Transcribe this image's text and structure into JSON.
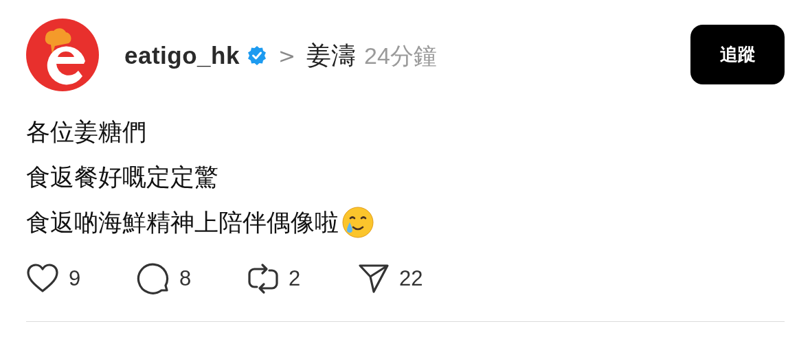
{
  "post": {
    "username": "eatigo_hk",
    "verified": true,
    "separator": ">",
    "topic": "姜濤",
    "time": "24分鐘",
    "follow_button": "追蹤",
    "lines": [
      "各位姜糖們",
      "食返餐好嘅定定驚",
      "食返啲海鮮精神上陪伴偶像啦"
    ],
    "actions": [
      {
        "kind": "like",
        "count": "9"
      },
      {
        "kind": "comment",
        "count": "8"
      },
      {
        "kind": "repost",
        "count": "2"
      },
      {
        "kind": "share",
        "count": "22"
      }
    ]
  }
}
